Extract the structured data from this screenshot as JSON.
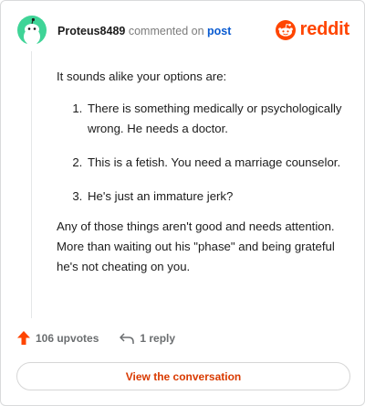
{
  "header": {
    "username": "Proteus8489",
    "action_text": "commented on",
    "post_link": "post",
    "logo_text": "reddit"
  },
  "comment": {
    "intro": "It sounds alike your options are:",
    "list": [
      "There is something medically or psychologically wrong. He needs a doctor.",
      "This is a fetish. You need a marriage counselor.",
      "He's just an immature jerk?"
    ],
    "closing": "Any of those things aren't good and needs attention. More than waiting out his \"phase\" and being grateful he's not cheating on you."
  },
  "footer": {
    "upvotes": "106 upvotes",
    "replies": "1 reply",
    "cta": "View the conversation"
  },
  "colors": {
    "accent": "#ff4500",
    "avatar": "#3fd497",
    "link": "#0a5bd1",
    "cta_text": "#d93a00"
  },
  "icons": {
    "avatar": "snoo-avatar-icon",
    "logo": "reddit-snoo-icon",
    "upvote": "upvote-arrow-icon",
    "reply": "reply-arrow-icon"
  }
}
